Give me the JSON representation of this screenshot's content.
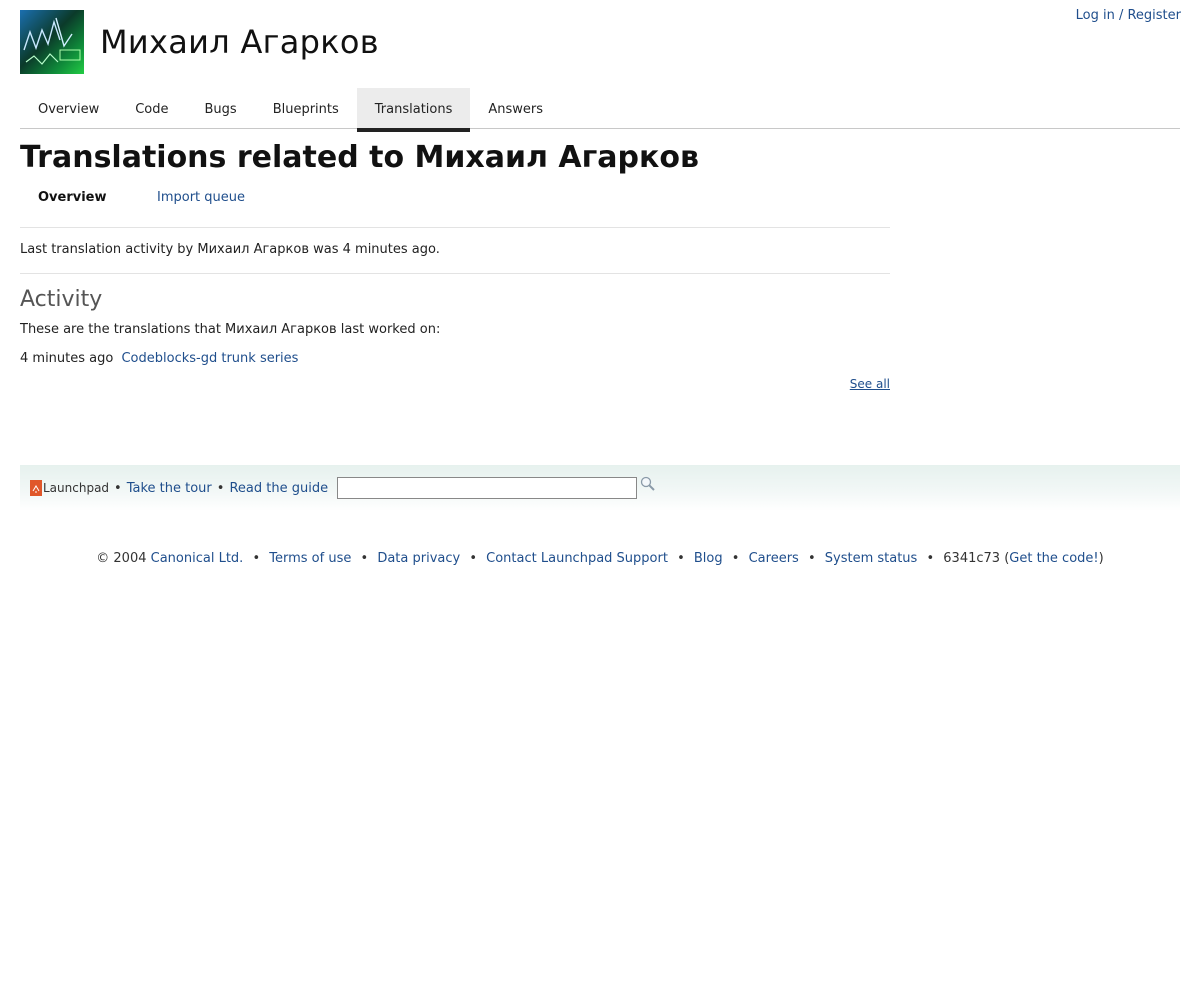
{
  "header": {
    "login_label": "Log in / Register",
    "site_title": "Михаил Агарков"
  },
  "tabs": [
    {
      "label": "Overview",
      "active": false
    },
    {
      "label": "Code",
      "active": false
    },
    {
      "label": "Bugs",
      "active": false
    },
    {
      "label": "Blueprints",
      "active": false
    },
    {
      "label": "Translations",
      "active": true
    },
    {
      "label": "Answers",
      "active": false
    }
  ],
  "main": {
    "title": "Translations related to Михаил Агарков",
    "subnav": {
      "current": "Overview",
      "import_queue": "Import queue"
    },
    "last_activity": "Last translation activity by Михаил Агарков was 4 minutes ago.",
    "activity_heading": "Activity",
    "activity_desc": "These are the translations that Михаил Агарков last worked on:",
    "activity_items": [
      {
        "time": "4 minutes ago",
        "link": "Codeblocks-gd trunk series"
      }
    ],
    "see_all": "See all"
  },
  "footer": {
    "launchpad_label": "Launchpad",
    "tour_label": "Take the tour",
    "guide_label": "Read the guide",
    "search_value": "",
    "separator": "•",
    "copyright_prefix": "© 2004",
    "links": {
      "canonical": "Canonical Ltd.",
      "terms": "Terms of use",
      "privacy": "Data privacy",
      "contact": "Contact Launchpad Support",
      "blog": "Blog",
      "careers": "Careers",
      "status": "System status"
    },
    "revision": "6341c73",
    "get_code": "Get the code!"
  },
  "colors": {
    "link": "#1f4e8c",
    "tab_active_bg": "#ececec",
    "launchpad_orange": "#e0572a"
  }
}
